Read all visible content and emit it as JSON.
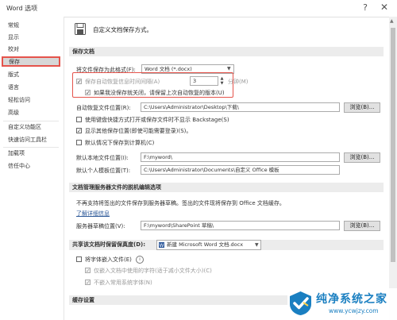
{
  "window": {
    "title": "Word 选项",
    "help_glyph": "?",
    "close_glyph": "✕"
  },
  "sidebar": {
    "items": [
      {
        "label": "常规"
      },
      {
        "label": "显示"
      },
      {
        "label": "校对"
      },
      {
        "label": "保存",
        "selected": true
      },
      {
        "label": "版式"
      },
      {
        "label": "语言"
      },
      {
        "label": "轻松访问"
      },
      {
        "label": "高级"
      },
      {
        "label": "自定义功能区"
      },
      {
        "label": "快速访问工具栏"
      },
      {
        "label": "加载项"
      },
      {
        "label": "信任中心"
      }
    ]
  },
  "main": {
    "header": "自定义文档保存方式。",
    "save_section": {
      "title": "保存文档",
      "format_label": "将文件保存为此格式(F):",
      "format_value": "Word 文档 (*.docx)",
      "autorecover_label": "保存自动恢复信息时间间隔(A)",
      "autorecover_checked": true,
      "autorecover_minutes": "3",
      "minutes_label": "分钟(M)",
      "keep_last_label": "如果我没保存就关闭，请保留上次自动恢复的版本(U)",
      "keep_last_checked": true,
      "autorecover_path_label": "自动恢复文件位置(R):",
      "autorecover_path": "C:\\Users\\Administrator\\Desktop\\下载\\",
      "browse_label": "浏览(B)...",
      "backstage_label": "使用键盘快捷方式打开或保存文件时不显示 Backstage(S)",
      "backstage_checked": false,
      "show_more_label": "显示其他保存位置(即使可能需要登录)(S)。",
      "show_more_checked": true,
      "default_pc_label": "默认情况下保存到计算机(C)",
      "default_pc_checked": false,
      "local_path_label": "默认本地文件位置(I):",
      "local_path": "F:\\myword\\",
      "browse2_label": "浏览(B)...",
      "template_path_label": "默认个人模板位置(T):",
      "template_path": "C:\\Users\\Administrator\\Documents\\自定义 Office 模板"
    },
    "offline_section": {
      "title": "文档管理服务器文件的脱机编辑选项",
      "note": "不再支持将签出的文件保存到服务器草稿。签出的文件现将保存到 Office 文档缓存。",
      "link": "了解详细信息",
      "drafts_label": "服务器草稿位置(V):",
      "drafts_path": "F:\\myword\\SharePoint 草稿\\",
      "browse3_label": "浏览(B)..."
    },
    "fidelity_section": {
      "label": "共享该文档时保留保真度(D):",
      "doc_value": "新建 Microsoft Word 文档.docx",
      "embed_label": "将字体嵌入文件(E)",
      "embed_checked": false,
      "embed_info": "i",
      "only_used_label": "仅嵌入文档中使用的字符(适于减小文件大小)(C)",
      "only_used_checked": true,
      "no_common_label": "不嵌入常用系统字体(N)",
      "no_common_checked": true
    },
    "cache_section": {
      "title": "缓存设置"
    }
  },
  "scrollbar": {
    "up_glyph": "▲"
  },
  "watermark": {
    "title": "纯净系统之家",
    "url": "www.ycwjzy.com"
  },
  "colors": {
    "highlight": "#e5534b",
    "selected_bg": "#d7d7d7",
    "link": "#2b5797",
    "word_blue": "#2b579a",
    "watermark": "#1a7fc1"
  }
}
